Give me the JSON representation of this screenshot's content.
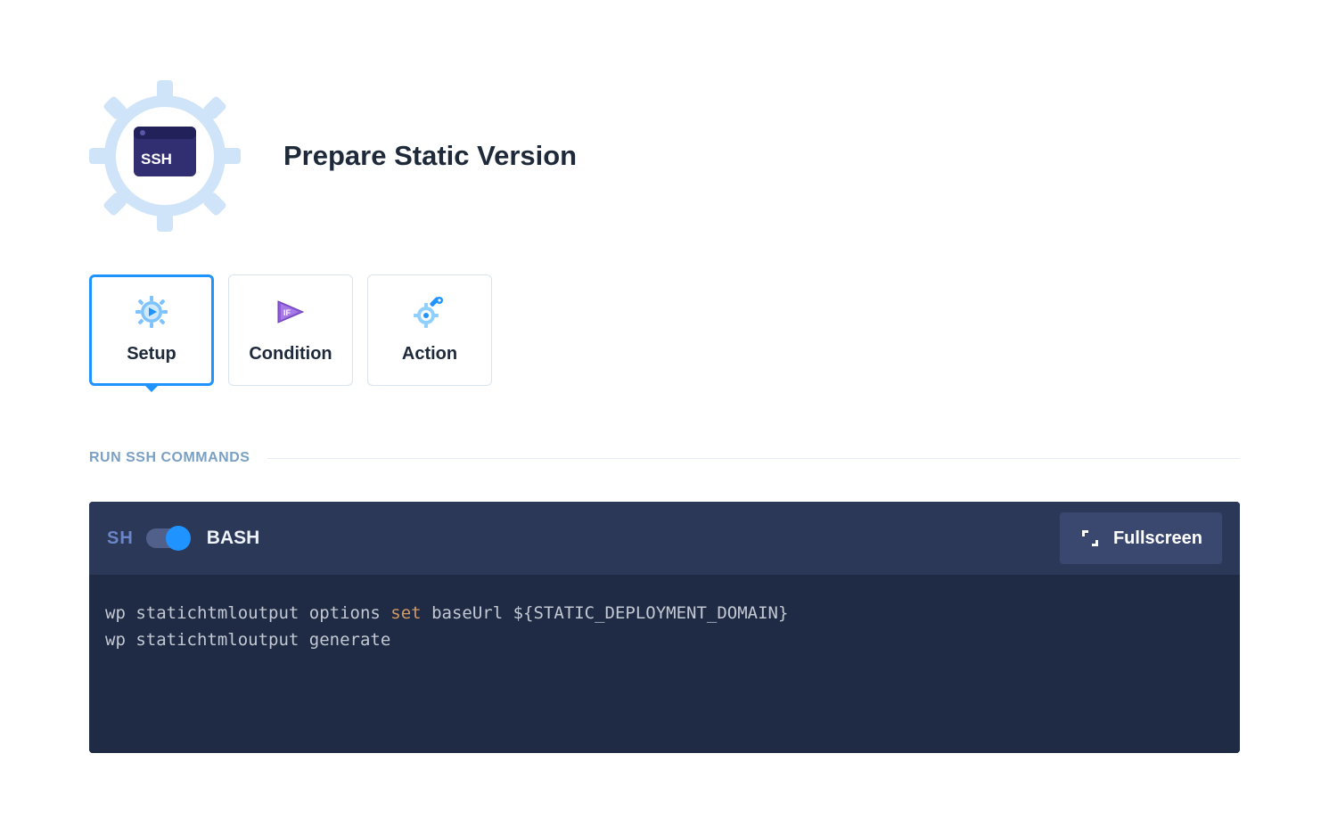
{
  "header": {
    "title": "Prepare Static Version",
    "badge_label": "SSH"
  },
  "tabs": [
    {
      "id": "setup",
      "label": "Setup",
      "icon": "gear-play-icon",
      "active": true
    },
    {
      "id": "condition",
      "label": "Condition",
      "icon": "if-triangle-icon",
      "active": false
    },
    {
      "id": "action",
      "label": "Action",
      "icon": "wrench-gear-icon",
      "active": false
    }
  ],
  "section": {
    "title": "RUN SSH COMMANDS"
  },
  "editor": {
    "sh_label": "SH",
    "mode_label": "BASH",
    "toggle_on": true,
    "fullscreen_label": "Fullscreen",
    "lines": [
      {
        "pre": "wp statichtmloutput options ",
        "kw": "set",
        "post": " baseUrl ${STATIC_DEPLOYMENT_DOMAIN}"
      },
      {
        "pre": "wp statichtmloutput generate",
        "kw": "",
        "post": ""
      }
    ]
  },
  "colors": {
    "accent": "#1f93ff",
    "badge_fill": "#312e72",
    "gear_tint": "#cfe4f8",
    "section_title": "#7aa0c4",
    "editor_bg": "#1f2a44",
    "toolbar_bg": "#2c3858"
  }
}
